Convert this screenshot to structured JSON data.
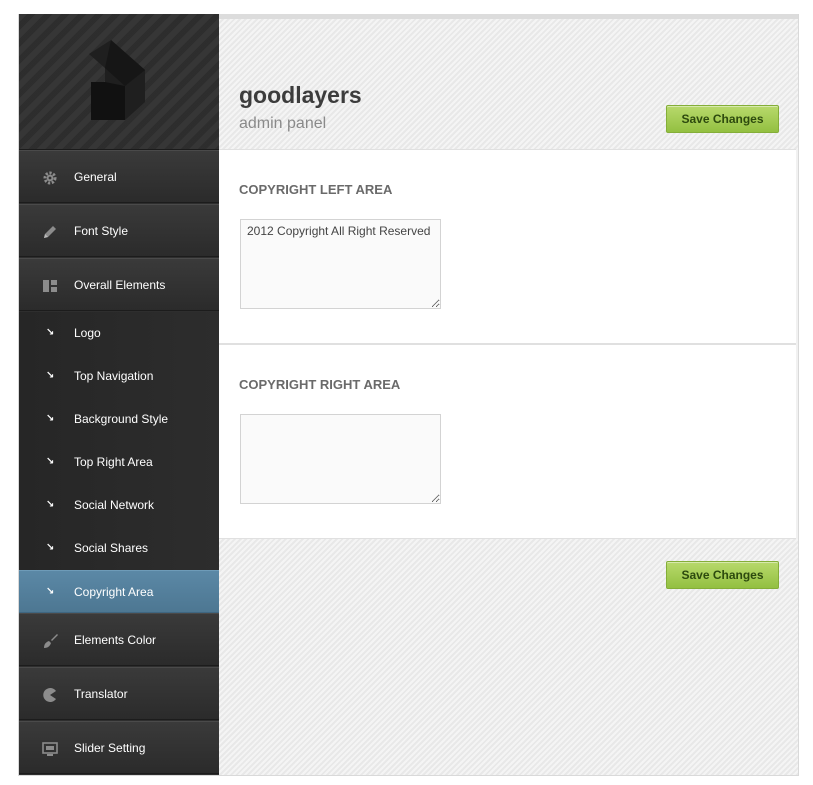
{
  "brand": {
    "title": "goodlayers",
    "subtitle": "admin panel"
  },
  "actions": {
    "save_label": "Save Changes"
  },
  "sidebar": {
    "main_items": [
      {
        "label": "General",
        "icon": "gear-icon"
      },
      {
        "label": "Font Style",
        "icon": "pencil-icon"
      },
      {
        "label": "Overall Elements",
        "icon": "layout-icon"
      }
    ],
    "sub_items": [
      {
        "label": "Logo",
        "icon": "arrow-down-right-icon",
        "active": false
      },
      {
        "label": "Top Navigation",
        "icon": "arrow-down-right-icon",
        "active": false
      },
      {
        "label": "Background Style",
        "icon": "arrow-down-right-icon",
        "active": false
      },
      {
        "label": "Top Right Area",
        "icon": "arrow-down-right-icon",
        "active": false
      },
      {
        "label": "Social Network",
        "icon": "arrow-down-right-icon",
        "active": false
      },
      {
        "label": "Social Shares",
        "icon": "arrow-down-right-icon",
        "active": false
      },
      {
        "label": "Copyright Area",
        "icon": "arrow-down-right-icon",
        "active": true
      }
    ],
    "bottom_items": [
      {
        "label": "Elements Color",
        "icon": "brush-icon"
      },
      {
        "label": "Translator",
        "icon": "pacman-icon"
      },
      {
        "label": "Slider Setting",
        "icon": "slider-icon"
      }
    ]
  },
  "sections": {
    "copyright_left": {
      "heading": "COPYRIGHT LEFT AREA",
      "value": "2012 Copyright All Right Reserved"
    },
    "copyright_right": {
      "heading": "COPYRIGHT RIGHT AREA",
      "value": ""
    }
  },
  "colors": {
    "sidebar_bg": "#2e2e2e",
    "active_item": "#5b88a6",
    "save_button": "#a6cd57",
    "heading_text": "#6a6a6a"
  }
}
